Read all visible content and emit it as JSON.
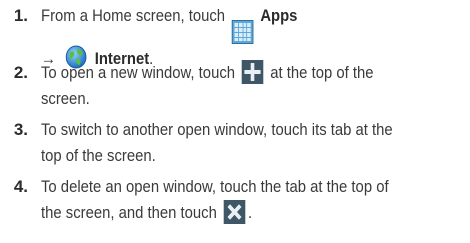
{
  "steps": [
    {
      "number": "1.",
      "text_a": "From a Home screen, touch",
      "apps_label": "Apps",
      "arrow": "→",
      "internet_label": "Internet",
      "text_b": "."
    },
    {
      "number": "2.",
      "text_a": "To open a new window, touch",
      "text_b": "at the top of the",
      "text_c": "screen."
    },
    {
      "number": "3.",
      "text_a": "To switch to another open window, touch its tab at the",
      "text_b": "top of the screen."
    },
    {
      "number": "4.",
      "text_a": "To delete an open window, touch the tab at the top of",
      "text_b": "the screen, and then touch",
      "text_c": "."
    }
  ],
  "icons": {
    "apps": "apps-grid-icon",
    "internet": "globe-icon",
    "new_window": "plus-icon",
    "close": "close-x-icon"
  }
}
